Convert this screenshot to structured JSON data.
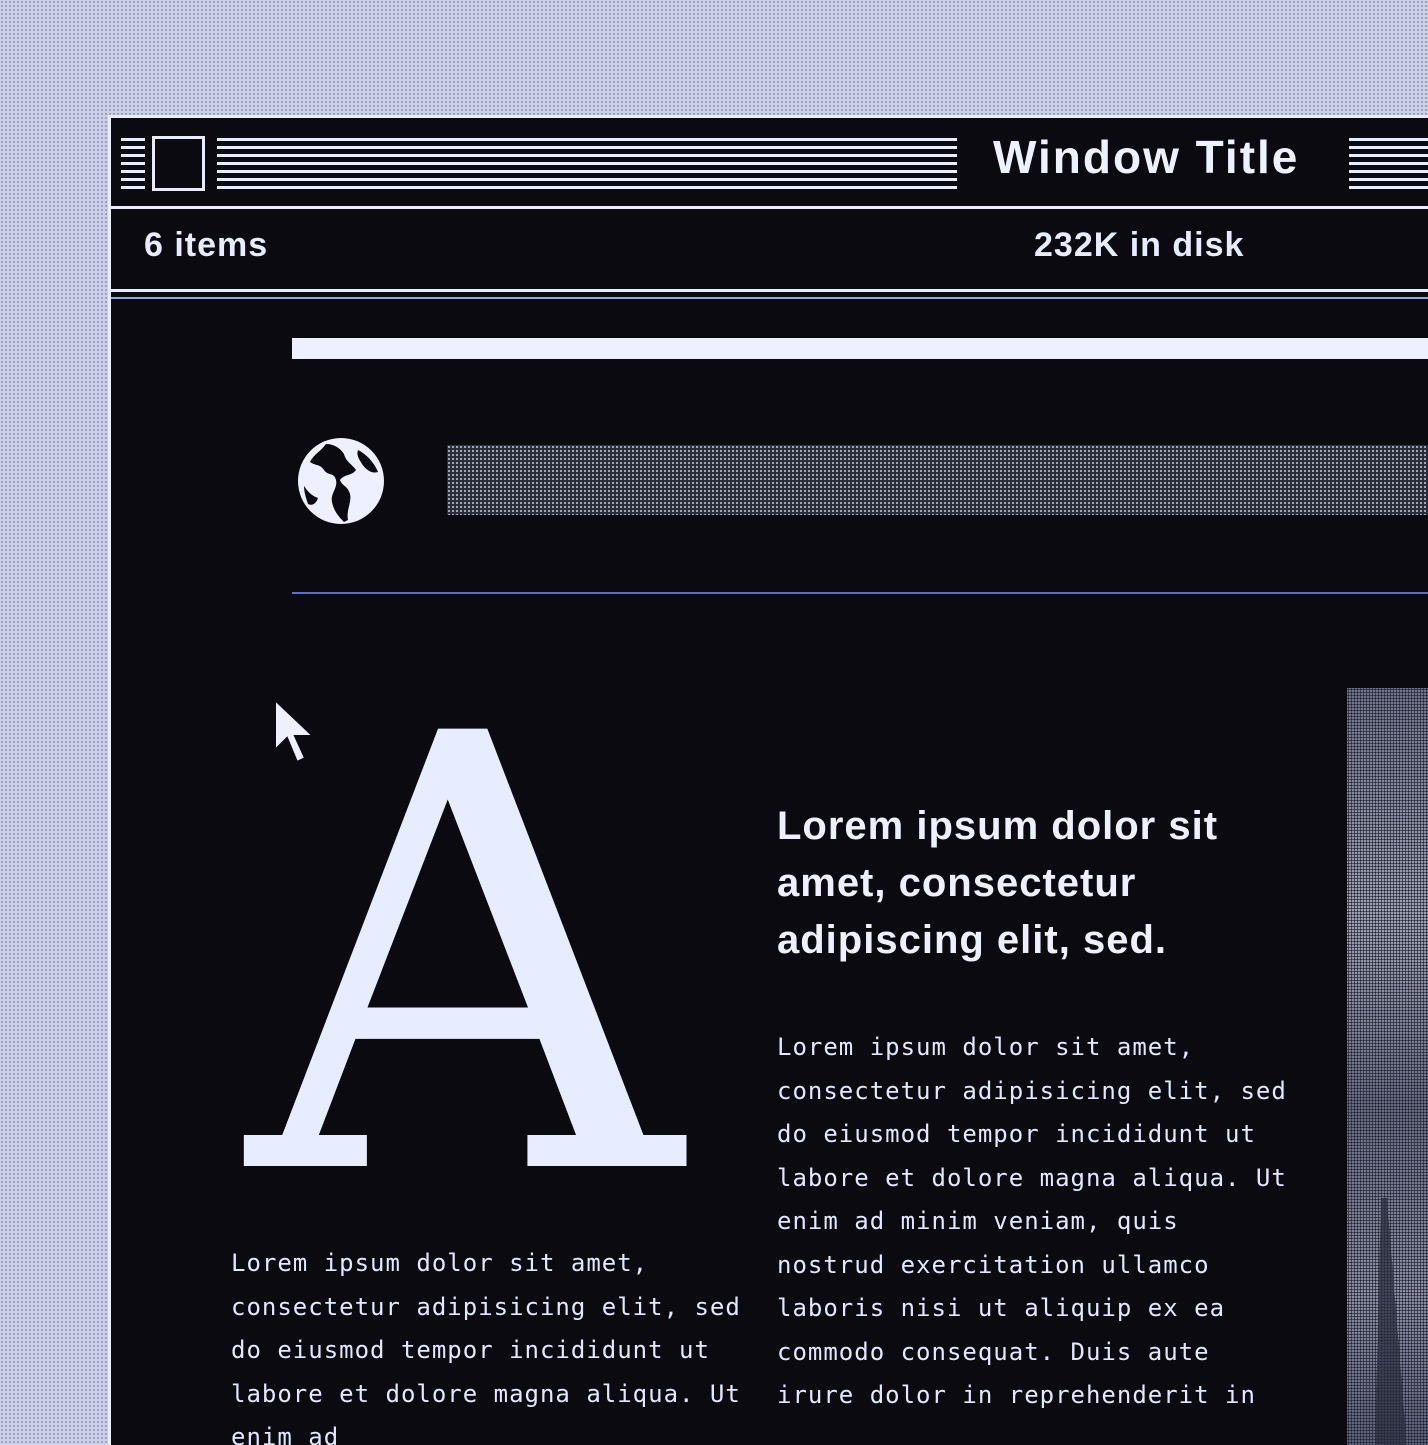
{
  "window": {
    "title": "Window Title"
  },
  "info_bar": {
    "item_count": "6 items",
    "disk_space": "232K in disk"
  },
  "content": {
    "drop_cap": "A",
    "heading": "Lorem ipsum dolor sit amet, consectetur adipiscing elit, sed.",
    "body_right": "Lorem ipsum dolor sit amet, consectetur adipisicing elit, sed do eiusmod tempor incididunt ut labore et dolore magna aliqua. Ut enim ad minim veniam, quis nostrud exercitation ullamco laboris nisi ut aliquip ex ea commodo consequat. Duis aute irure dolor in reprehenderit in",
    "body_left": "Lorem ipsum dolor sit amet, consectetur adipisicing elit, sed do eiusmod tempor incididunt ut labore et dolore magna aliqua. Ut enim ad"
  },
  "icons": {
    "close": "close-box-icon",
    "globe": "globe-icon",
    "pointer": "arrow-cursor-icon"
  },
  "colors": {
    "desktop": "#c9cfe4",
    "window_background": "#0a0a10",
    "foreground": "#eef0ff",
    "accent_rule": "#5f6cc6"
  }
}
